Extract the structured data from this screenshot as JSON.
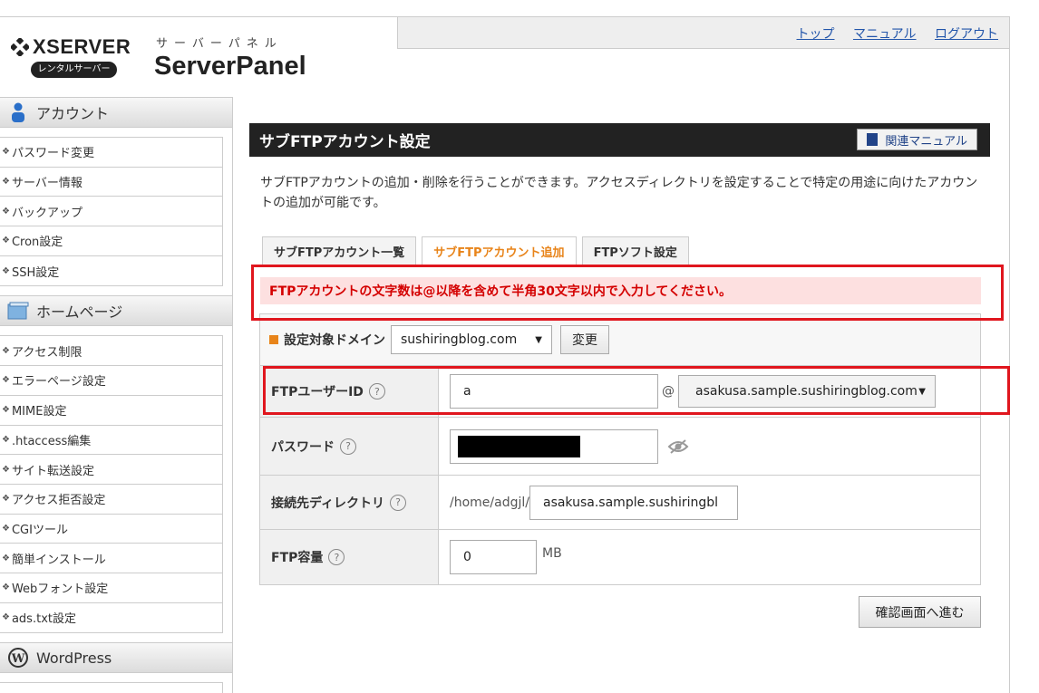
{
  "header": {
    "brand": "XSERVER",
    "brand_badge": "レンタルサーバー",
    "product_kana": "サーバーパネル",
    "product_name": "ServerPanel",
    "links": {
      "top": "トップ",
      "manual": "マニュアル",
      "logout": "ログアウト"
    }
  },
  "sidebar": {
    "account": {
      "title": "アカウント",
      "items": [
        "パスワード変更",
        "サーバー情報",
        "バックアップ",
        "Cron設定",
        "SSH設定"
      ]
    },
    "homepage": {
      "title": "ホームページ",
      "items": [
        "アクセス制限",
        "エラーページ設定",
        "MIME設定",
        ".htaccess編集",
        "サイト転送設定",
        "アクセス拒否設定",
        "CGIツール",
        "簡単インストール",
        "Webフォント設定",
        "ads.txt設定"
      ]
    },
    "wordpress": {
      "title": "WordPress"
    }
  },
  "main": {
    "title": "サブFTPアカウント設定",
    "manual_button": "関連マニュアル",
    "description": "サブFTPアカウントの追加・削除を行うことができます。アクセスディレクトリを設定することで特定の用途に向けたアカウントの追加が可能です。",
    "tabs": [
      {
        "label": "サブFTPアカウント一覧",
        "active": false
      },
      {
        "label": "サブFTPアカウント追加",
        "active": true
      },
      {
        "label": "FTPソフト設定",
        "active": false
      }
    ],
    "error_message": "FTPアカウントの文字数は@以降を含めて半角30文字以内で入力してください。",
    "domain": {
      "label": "設定対象ドメイン",
      "selected": "sushiringblog.com",
      "change_button": "変更"
    },
    "form": {
      "ftp_user_id": {
        "label": "FTPユーザーID",
        "value": "a",
        "at": "@",
        "domain": "asakusa.sample.sushiringblog.com"
      },
      "password": {
        "label": "パスワード"
      },
      "directory": {
        "label": "接続先ディレクトリ",
        "prefix": "/home/adgjl/",
        "value": "asakusa.sample.sushiringbl"
      },
      "capacity": {
        "label": "FTP容量",
        "value": "0",
        "unit": "MB"
      }
    },
    "help_glyph": "?",
    "confirm_button": "確認画面へ進む"
  },
  "colors": {
    "accent_orange": "#e8841a",
    "error_red": "#e0161e",
    "link_blue": "#2255aa"
  }
}
